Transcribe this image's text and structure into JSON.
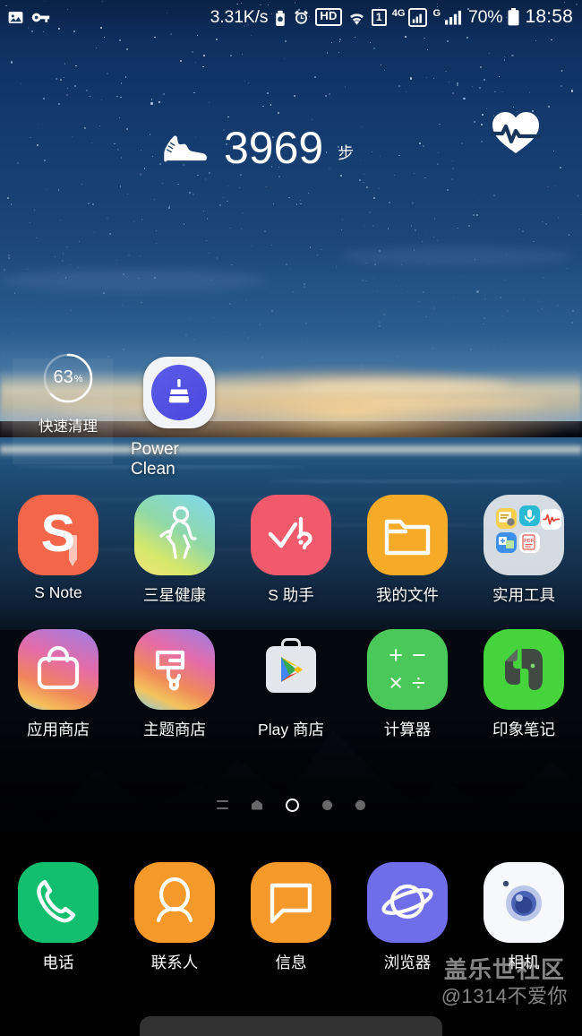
{
  "status_bar": {
    "left_icons": [
      {
        "name": "screenshot-image-icon",
        "glyph": "image"
      },
      {
        "name": "vpn-key-icon",
        "glyph": "key"
      }
    ],
    "network_speed": "3.31K/s",
    "right_icons": [
      {
        "name": "data-saver-icon",
        "glyph": "saver"
      },
      {
        "name": "alarm-clock-icon",
        "glyph": "alarm"
      },
      {
        "name": "hd-voice-badge",
        "label": "HD"
      },
      {
        "name": "wifi-icon",
        "glyph": "wifi"
      },
      {
        "name": "sim-one-badge",
        "label": "1"
      },
      {
        "name": "network-type-4g",
        "label": "4G"
      },
      {
        "name": "signal-bars-sim1",
        "glyph": "signal-boxed"
      },
      {
        "name": "network-type-g",
        "label": "G"
      },
      {
        "name": "signal-bars-sim2",
        "glyph": "signal"
      }
    ],
    "battery_percent": "70%",
    "clock": "18:58"
  },
  "step_widget": {
    "icon_name": "running-shoe-icon",
    "count": "3969",
    "unit": "步",
    "heart_rate_icon": "heart-pulse-icon"
  },
  "quick_clean": {
    "percent": "63",
    "percent_symbol": "%",
    "label": "快速清理"
  },
  "power_clean": {
    "label": "Power Clean",
    "icon_name": "broom-icon",
    "accent": "#4f4ce0"
  },
  "rows": [
    {
      "name": "app-row-1",
      "apps": [
        {
          "label": "S Note",
          "icon": "s-note-icon",
          "key": "snote"
        },
        {
          "label": "三星健康",
          "icon": "samsung-health-icon",
          "key": "health"
        },
        {
          "label": "S 助手",
          "icon": "s-assistant-icon",
          "key": "sassist"
        },
        {
          "label": "我的文件",
          "icon": "my-files-folder-icon",
          "key": "files"
        },
        {
          "label": "实用工具",
          "icon": "utilities-folder-icon",
          "key": "folder"
        }
      ]
    },
    {
      "name": "app-row-2",
      "apps": [
        {
          "label": "应用商店",
          "icon": "galaxy-apps-icon",
          "key": "galaxy"
        },
        {
          "label": "主题商店",
          "icon": "theme-store-icon",
          "key": "theme"
        },
        {
          "label": "Play 商店",
          "icon": "play-store-icon",
          "key": "play"
        },
        {
          "label": "计算器",
          "icon": "calculator-icon",
          "key": "calc"
        },
        {
          "label": "印象笔记",
          "icon": "evernote-icon",
          "key": "ever"
        }
      ]
    }
  ],
  "dock": {
    "name": "dock",
    "apps": [
      {
        "label": "电话",
        "icon": "phone-icon",
        "key": "phone"
      },
      {
        "label": "联系人",
        "icon": "contacts-icon",
        "key": "contacts"
      },
      {
        "label": "信息",
        "icon": "messages-icon",
        "key": "msg"
      },
      {
        "label": "浏览器",
        "icon": "browser-icon",
        "key": "browser"
      },
      {
        "label": "相机",
        "icon": "camera-icon",
        "key": "camera"
      }
    ]
  },
  "page_indicator": {
    "items": [
      "list-glyph",
      "home-glyph",
      "active-ring",
      "dot",
      "dot"
    ],
    "active_index": 2
  },
  "watermark": {
    "line1": "盖乐世社区",
    "line2": "@1314不爱你"
  },
  "calculator_symbols": [
    "+",
    "−",
    "×",
    "÷"
  ],
  "folder_minis": [
    {
      "name": "notes-mini-icon",
      "bg": "#f2c84b",
      "glyph": "▤"
    },
    {
      "name": "voice-recorder-mini-icon",
      "bg": "#2bb8cf",
      "glyph": "⬤"
    },
    {
      "name": "sound-wave-mini-icon",
      "bg": "#ffffff",
      "glyph": "∿"
    },
    {
      "name": "translate-mini-icon",
      "bg": "#3c8ce8",
      "glyph": "文"
    },
    {
      "name": "pdf-mini-icon",
      "bg": "#ffffff",
      "glyph": "PDF"
    }
  ]
}
